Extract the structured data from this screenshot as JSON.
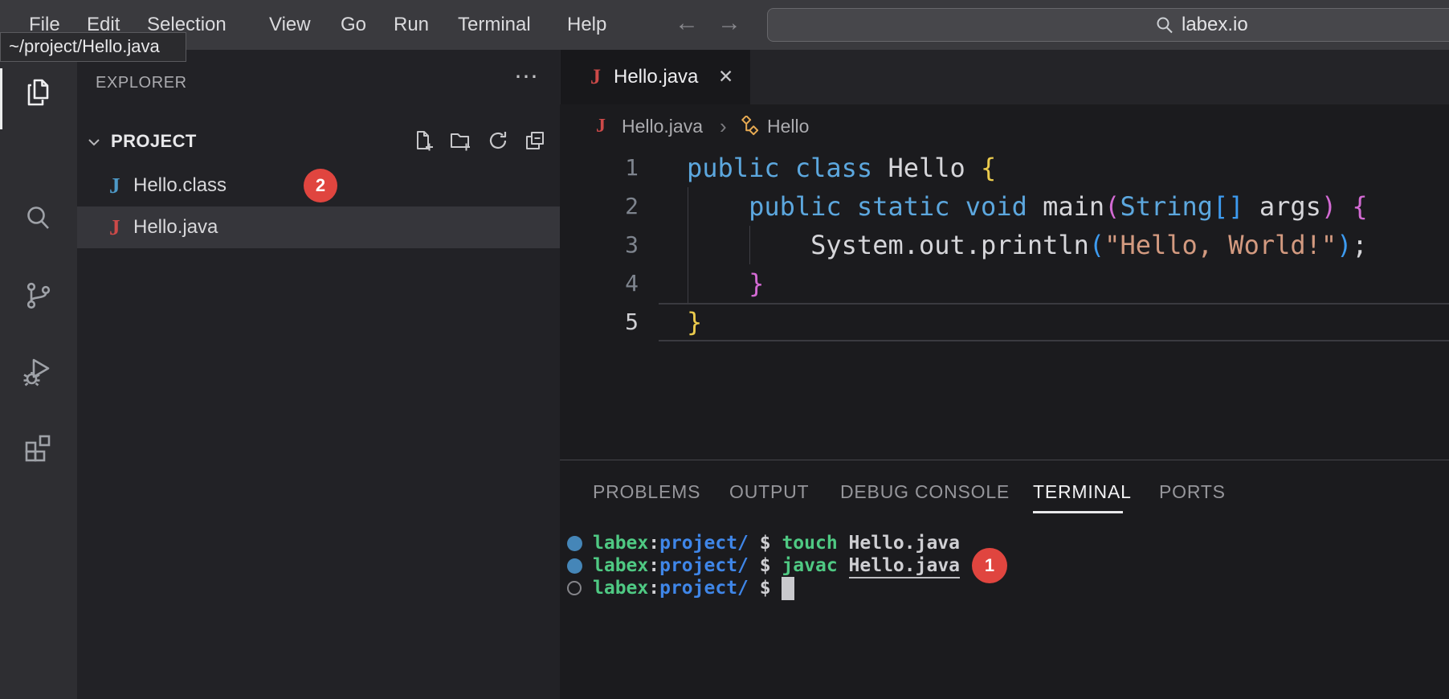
{
  "menu_bar": {
    "items": [
      "File",
      "Edit",
      "Selection",
      "View",
      "Go",
      "Run",
      "Terminal",
      "Help"
    ],
    "back_arrow": "←",
    "forward_arrow": "→",
    "search_text": "labex.io",
    "search_icon": "magnifier"
  },
  "tooltip": {
    "text": "~/project/Hello.java"
  },
  "activity_bar": {
    "icons": [
      "explorer-icon",
      "search-icon",
      "source-control-icon",
      "run-debug-icon",
      "extensions-icon"
    ],
    "active": "explorer-icon"
  },
  "sidebar": {
    "title": "EXPLORER",
    "more_icon": "⋯",
    "section": "PROJECT",
    "section_actions": [
      "new-file-icon",
      "new-folder-icon",
      "refresh-icon",
      "collapse-all-icon"
    ],
    "files": [
      {
        "name": "Hello.class",
        "icon_text": "J",
        "icon_color": "#4e9ac8",
        "badge": "2",
        "selected": false
      },
      {
        "name": "Hello.java",
        "icon_text": "J",
        "icon_color": "#cd4a49",
        "badge": "",
        "selected": true
      }
    ]
  },
  "editor": {
    "tab": {
      "icon_text": "J",
      "label": "Hello.java",
      "close": "✕"
    },
    "breadcrumb": {
      "file_icon": "J",
      "file": "Hello.java",
      "sep": "›",
      "symbol": "Hello"
    },
    "code_lines": [
      {
        "num": "1",
        "tokens": [
          [
            "kw",
            "public"
          ],
          [
            "pl",
            " "
          ],
          [
            "kw",
            "class"
          ],
          [
            "pl",
            " "
          ],
          [
            "id",
            "Hello"
          ],
          [
            "pl",
            " "
          ],
          [
            "b1",
            "{"
          ]
        ]
      },
      {
        "num": "2",
        "tokens": [
          [
            "pl",
            "    "
          ],
          [
            "kw",
            "public"
          ],
          [
            "pl",
            " "
          ],
          [
            "kw",
            "static"
          ],
          [
            "pl",
            " "
          ],
          [
            "kw",
            "void"
          ],
          [
            "pl",
            " "
          ],
          [
            "id",
            "main"
          ],
          [
            "b2",
            "("
          ],
          [
            "kw",
            "String"
          ],
          [
            "b3",
            "[]"
          ],
          [
            "pl",
            " "
          ],
          [
            "id",
            "args"
          ],
          [
            "b2",
            ")"
          ],
          [
            "pl",
            " "
          ],
          [
            "b2",
            "{"
          ]
        ]
      },
      {
        "num": "3",
        "tokens": [
          [
            "pl",
            "        "
          ],
          [
            "id",
            "System.out.println"
          ],
          [
            "b3",
            "("
          ],
          [
            "str",
            "\"Hello, World!\""
          ],
          [
            "b3",
            ")"
          ],
          [
            "id",
            ";"
          ]
        ]
      },
      {
        "num": "4",
        "tokens": [
          [
            "pl",
            "    "
          ],
          [
            "b2",
            "}"
          ]
        ]
      },
      {
        "num": "5",
        "tokens": [
          [
            "b1",
            "}"
          ]
        ],
        "current": true
      }
    ]
  },
  "panel": {
    "tabs": [
      "PROBLEMS",
      "OUTPUT",
      "DEBUG CONSOLE",
      "TERMINAL",
      "PORTS"
    ],
    "active_tab": "TERMINAL",
    "terminal_lines": [
      {
        "dot": "filled",
        "tokens": [
          [
            "g",
            "labex"
          ],
          [
            "w",
            ":"
          ],
          [
            "bl",
            "project/"
          ],
          [
            "w",
            " $ "
          ],
          [
            "g",
            "touch"
          ],
          [
            "w",
            " Hello.java"
          ]
        ],
        "badge": "",
        "cursor": false
      },
      {
        "dot": "filled",
        "tokens": [
          [
            "g",
            "labex"
          ],
          [
            "w",
            ":"
          ],
          [
            "bl",
            "project/"
          ],
          [
            "w",
            " $ "
          ],
          [
            "g",
            "javac"
          ],
          [
            "w",
            " "
          ],
          [
            "wu",
            "Hello.java"
          ]
        ],
        "badge": "1",
        "cursor": false
      },
      {
        "dot": "empty",
        "tokens": [
          [
            "g",
            "labex"
          ],
          [
            "w",
            ":"
          ],
          [
            "bl",
            "project/"
          ],
          [
            "w",
            " $ "
          ]
        ],
        "badge": "",
        "cursor": true
      }
    ]
  },
  "colors": {
    "badge_red": "#e0453f",
    "keyword_blue": "#5CA7DE",
    "bracket_gold": "#EBCB4D",
    "bracket_magenta": "#D36AD3",
    "bracket_blue": "#3D9BF0",
    "string_salmon": "#D39A80",
    "terminal_green": "#4FC983",
    "terminal_blue": "#3F86E8",
    "class_symbol_orange": "#E8AB53"
  }
}
